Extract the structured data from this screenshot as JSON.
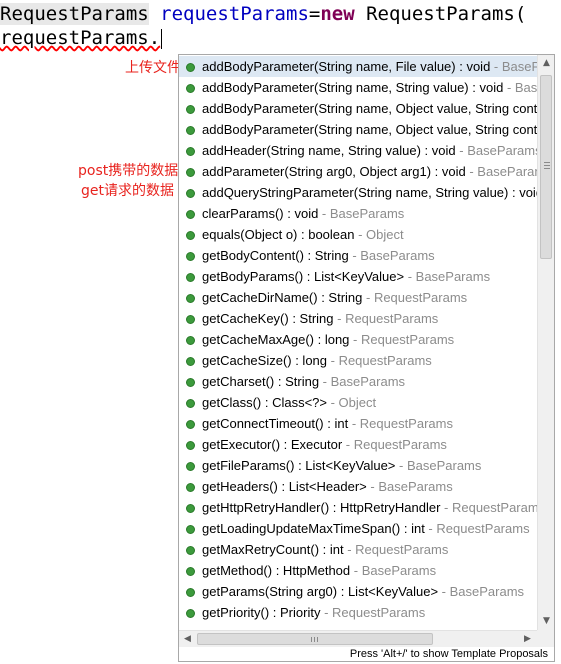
{
  "editor": {
    "line1": {
      "type": "RequestParams",
      "space": " ",
      "variable": "requestParams",
      "equals": "=",
      "keyword": "new",
      "rest": " RequestParams("
    },
    "line2": {
      "text": "requestParams."
    }
  },
  "annotations": {
    "upload": "上传文件",
    "post": "post携带的数据",
    "get": "get请求的数据"
  },
  "colors": {
    "annotation": "#e8231e",
    "keyword": "#7f0055",
    "variable": "#0000c0",
    "owner": "#8c8c8c",
    "method_dot": "#3c9a3c",
    "selected_row": "#dde8f3"
  },
  "proposals": [
    {
      "signature": "addBodyParameter(String name, File value) : void",
      "owner": " - BaseParams"
    },
    {
      "signature": "addBodyParameter(String name, String value) : void",
      "owner": " - BaseParams"
    },
    {
      "signature": "addBodyParameter(String name, Object value, String contentType)",
      "owner": ""
    },
    {
      "signature": "addBodyParameter(String name, Object value, String contentType, String fileName)",
      "owner": ""
    },
    {
      "signature": "addHeader(String name, String value) : void",
      "owner": " - BaseParams"
    },
    {
      "signature": "addParameter(String arg0, Object arg1) : void",
      "owner": " - BaseParams"
    },
    {
      "signature": "addQueryStringParameter(String name, String value) : void",
      "owner": ""
    },
    {
      "signature": "clearParams() : void",
      "owner": " - BaseParams"
    },
    {
      "signature": "equals(Object o) : boolean",
      "owner": " - Object"
    },
    {
      "signature": "getBodyContent() : String",
      "owner": " - BaseParams"
    },
    {
      "signature": "getBodyParams() : List<KeyValue>",
      "owner": " - BaseParams"
    },
    {
      "signature": "getCacheDirName() : String",
      "owner": " - RequestParams"
    },
    {
      "signature": "getCacheKey() : String",
      "owner": " - RequestParams"
    },
    {
      "signature": "getCacheMaxAge() : long",
      "owner": " - RequestParams"
    },
    {
      "signature": "getCacheSize() : long",
      "owner": " - RequestParams"
    },
    {
      "signature": "getCharset() : String",
      "owner": " - BaseParams"
    },
    {
      "signature": "getClass() : Class<?>",
      "owner": " - Object"
    },
    {
      "signature": "getConnectTimeout() : int",
      "owner": " - RequestParams"
    },
    {
      "signature": "getExecutor() : Executor",
      "owner": " - RequestParams"
    },
    {
      "signature": "getFileParams() : List<KeyValue>",
      "owner": " - BaseParams"
    },
    {
      "signature": "getHeaders() : List<Header>",
      "owner": " - BaseParams"
    },
    {
      "signature": "getHttpRetryHandler() : HttpRetryHandler",
      "owner": " - RequestParams"
    },
    {
      "signature": "getLoadingUpdateMaxTimeSpan() : int",
      "owner": " - RequestParams"
    },
    {
      "signature": "getMaxRetryCount() : int",
      "owner": " - RequestParams"
    },
    {
      "signature": "getMethod() : HttpMethod",
      "owner": " - BaseParams"
    },
    {
      "signature": "getParams(String arg0) : List<KeyValue>",
      "owner": " - BaseParams"
    },
    {
      "signature": "getPriority() : Priority",
      "owner": " - RequestParams"
    }
  ],
  "status_text": "Press 'Alt+/' to show Template Proposals",
  "scrollbar_icons": {
    "up": "▲",
    "down": "▼",
    "left": "◀",
    "right": "▶"
  }
}
